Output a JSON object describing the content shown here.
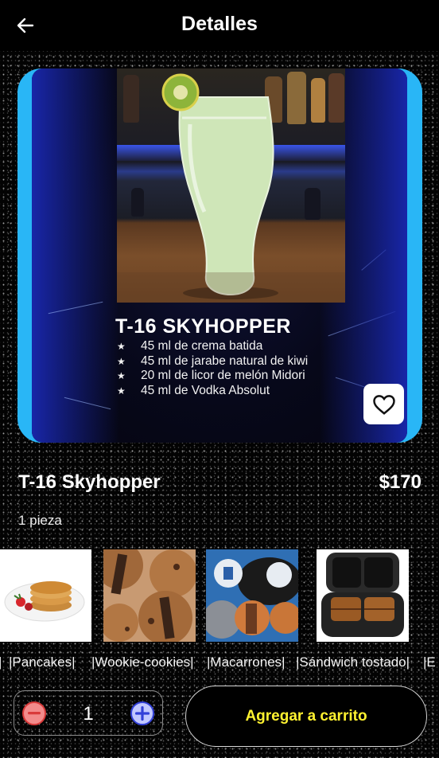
{
  "header": {
    "title": "Detalles",
    "back_icon": "arrow-left-icon"
  },
  "hero": {
    "cocktail_title": "T-16 SKYHOPPER",
    "ingredients": [
      "45 ml de crema batida",
      "45 ml de jarabe natural de kiwi",
      "20 ml de licor de melón Midori",
      "45 ml de Vodka Absolut"
    ],
    "favorite_icon": "heart-outline-icon",
    "frame_color": "#29b6f6"
  },
  "product": {
    "name": "T-16 Skyhopper",
    "price": "$170",
    "quantity_label": "1 pieza"
  },
  "suggestions": [
    {
      "label": "|Pancakes|"
    },
    {
      "label": "|Wookie-cookies|"
    },
    {
      "label": "|Macarrones|"
    },
    {
      "label": "|Sándwich tostado|"
    }
  ],
  "suggestions_edge_labels": {
    "left": "|",
    "right": "|E"
  },
  "cart": {
    "quantity": "1",
    "minus_icon": "minus-circle-icon",
    "plus_icon": "plus-circle-icon",
    "add_label": "Agregar a carrito",
    "accent_color": "#fff230"
  }
}
